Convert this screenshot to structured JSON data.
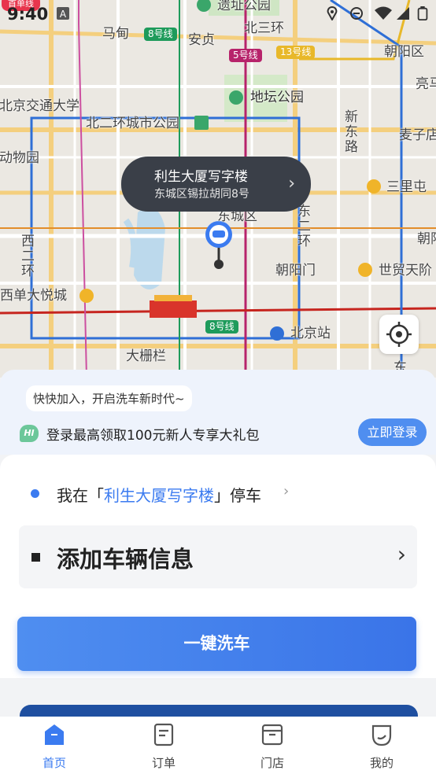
{
  "status_bar": {
    "time": "9:40",
    "carrier_tag": "首单线"
  },
  "map": {
    "labels": {
      "mapian": "马甸",
      "anzhen": "安贞",
      "beisanhuan": "北三环",
      "chaoyangqu": "朝阳区",
      "ditan": "地坛公园",
      "yizhi": "遗址公园",
      "bjtu": "北京交通大学",
      "beierhuan": "北二环城市公园",
      "dongwuyuan": "动物园",
      "xindonglu": "新东路",
      "maizi": "麦子店",
      "sanlitun": "三里屯",
      "dongchengqu": "东城区",
      "chaoyangmen": "朝阳门",
      "maoye": "世贸天阶",
      "xierhuan": "西二环",
      "dongerhuan": "东二环",
      "xidan": "西单大悦城",
      "dashilan": "大栅栏",
      "beijingzhan": "北京站",
      "liang": "亮马",
      "chaoy2": "朝阳",
      "dong": "东"
    },
    "lines": {
      "l8a": "8号线",
      "l5": "5号线",
      "l13": "13号线",
      "l8b": "8号线"
    }
  },
  "callout": {
    "title": "利生大厦写字楼",
    "address": "东城区锡拉胡同8号"
  },
  "login_card": {
    "slogan": "快快加入，开启洗车新时代~",
    "hi": "HI",
    "promo": "登录最高领取100元新人专享大礼包",
    "login_button": "立即登录"
  },
  "parking": {
    "prefix": "我在「",
    "place": "利生大厦写字楼",
    "suffix": "」停车"
  },
  "vehicle": {
    "label": "添加车辆信息"
  },
  "wash_button": "一键洗车",
  "tabs": [
    {
      "label": "首页",
      "icon": "home-icon"
    },
    {
      "label": "订单",
      "icon": "order-icon"
    },
    {
      "label": "门店",
      "icon": "store-icon"
    },
    {
      "label": "我的",
      "icon": "profile-icon"
    }
  ],
  "colors": {
    "accent": "#3b7bf0",
    "callout_bg": "#3a3f48"
  }
}
